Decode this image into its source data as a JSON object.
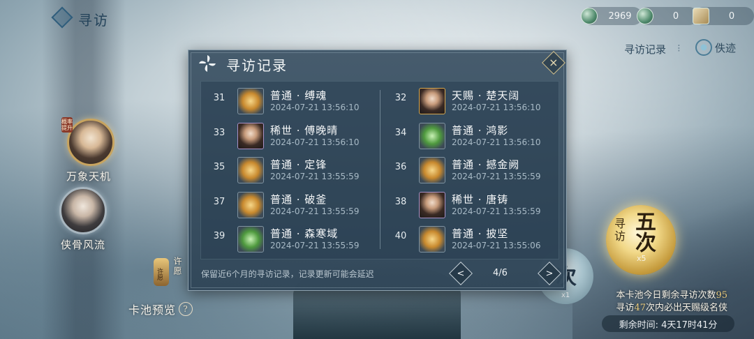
{
  "topbar": {
    "title": "寻访",
    "currencies": [
      {
        "icon": "jade-coin-icon",
        "value": "2969"
      },
      {
        "icon": "green-coin-icon",
        "value": "0"
      },
      {
        "icon": "scroll-ticket-icon",
        "value": "0"
      }
    ],
    "record_link": "寻访记录",
    "separator": "⁝",
    "lost_link": "佚迹"
  },
  "left_panel": {
    "pools": [
      {
        "label": "万象天机",
        "tag": "概率提升"
      },
      {
        "label": "侠骨风流"
      }
    ],
    "xinyuan": {
      "lamp_text": "许愿",
      "side_text": "许愿"
    },
    "pool_preview": "卡池预览",
    "help_icon": "?"
  },
  "right_panel": {
    "seek_five": {
      "small": "寻访",
      "big": "五次",
      "count": "x5"
    },
    "seek_once": {
      "big": "次",
      "count": "x1"
    },
    "remaining_prefix": "本卡池今日剩余寻访次数",
    "remaining_count": "95",
    "guarantee_prefix": "寻访",
    "guarantee_count": "47",
    "guarantee_suffix": "次内必出天赐级名侠",
    "timer": "剩余时间: 4天17时41分"
  },
  "dialog": {
    "title": "寻访记录",
    "close_icon": "close-icon",
    "records": [
      {
        "num": "31",
        "name": "普通 · 缚魂",
        "time": "2024-07-21 13:56:10",
        "thumb": "item"
      },
      {
        "num": "32",
        "name": "天赐 · 楚天阔",
        "time": "2024-07-21 13:56:10",
        "thumb": "char-gold"
      },
      {
        "num": "33",
        "name": "稀世 · 傅晚晴",
        "time": "2024-07-21 13:56:10",
        "thumb": "char"
      },
      {
        "num": "34",
        "name": "普通 · 鸿影",
        "time": "2024-07-21 13:56:10",
        "thumb": "green"
      },
      {
        "num": "35",
        "name": "普通 · 定锋",
        "time": "2024-07-21 13:55:59",
        "thumb": "item"
      },
      {
        "num": "36",
        "name": "普通 · 撼金阙",
        "time": "2024-07-21 13:55:59",
        "thumb": "item"
      },
      {
        "num": "37",
        "name": "普通 · 破釜",
        "time": "2024-07-21 13:55:59",
        "thumb": "item"
      },
      {
        "num": "38",
        "name": "稀世 · 唐铸",
        "time": "2024-07-21 13:55:59",
        "thumb": "char"
      },
      {
        "num": "39",
        "name": "普通 · 森寒域",
        "time": "2024-07-21 13:55:59",
        "thumb": "green"
      },
      {
        "num": "40",
        "name": "普通 · 披坚",
        "time": "2024-07-21 13:55:06",
        "thumb": "item"
      }
    ],
    "footer_note": "保留近6个月的寻访记录，记录更新可能会延迟",
    "prev": "<",
    "next": ">",
    "page": "4/6"
  }
}
